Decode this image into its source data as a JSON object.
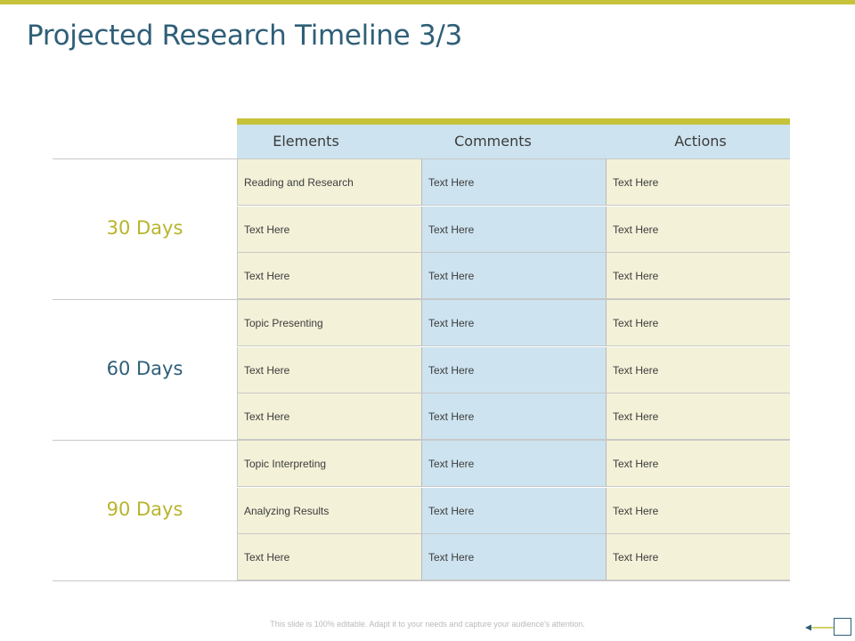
{
  "title": "Projected Research Timeline 3/3",
  "columns": [
    "Elements",
    "Comments",
    "Actions"
  ],
  "groups": [
    {
      "label": "30 Days",
      "color": "#b9b42c",
      "rows": [
        [
          "Reading and Research",
          "Text Here",
          "Text Here"
        ],
        [
          "Text Here",
          "Text Here",
          "Text Here"
        ],
        [
          "Text Here",
          "Text Here",
          "Text Here"
        ]
      ]
    },
    {
      "label": "60 Days",
      "color": "#2f5f78",
      "rows": [
        [
          "Topic Presenting",
          "Text Here",
          "Text Here"
        ],
        [
          "Text Here",
          "Text Here",
          "Text Here"
        ],
        [
          "Text Here",
          "Text Here",
          "Text Here"
        ]
      ]
    },
    {
      "label": "90 Days",
      "color": "#b9b42c",
      "rows": [
        [
          "Topic Interpreting",
          "Text Here",
          "Text Here"
        ],
        [
          "Analyzing Results",
          "Text Here",
          "Text Here"
        ],
        [
          "Text Here",
          "Text Here",
          "Text Here"
        ]
      ]
    }
  ],
  "footer": "This slide is 100% editable. Adapt it to your needs and capture your audience's attention.",
  "colors": {
    "accent": "#c6c23a",
    "title": "#2f5f78",
    "cream": "#f3f1d8",
    "light_blue": "#cde3ef"
  }
}
